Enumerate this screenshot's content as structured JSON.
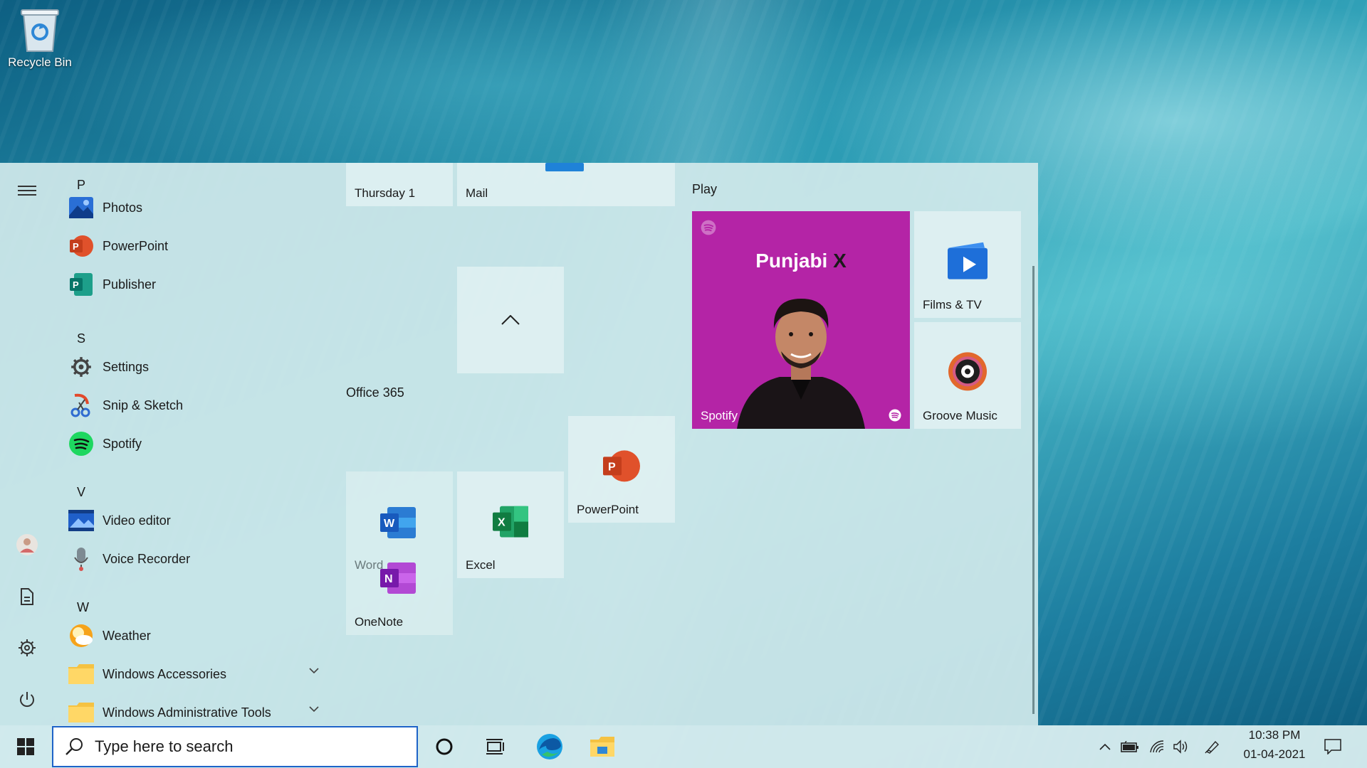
{
  "desktop": {
    "icons": [
      {
        "label": "Recycle Bin",
        "icon": "recycle-bin-icon"
      }
    ]
  },
  "start_menu": {
    "rail": {
      "menu_icon": "hamburger-icon",
      "user_icon": "user-avatar-icon",
      "documents_icon": "documents-icon",
      "settings_icon": "gear-icon",
      "power_icon": "power-icon"
    },
    "app_list": [
      {
        "type": "letter",
        "label": "P"
      },
      {
        "type": "app",
        "label": "Photos",
        "icon": "photos-icon"
      },
      {
        "type": "app",
        "label": "PowerPoint",
        "icon": "powerpoint-icon"
      },
      {
        "type": "app",
        "label": "Publisher",
        "icon": "publisher-icon"
      },
      {
        "type": "letter",
        "label": "S"
      },
      {
        "type": "app",
        "label": "Settings",
        "icon": "gear-icon"
      },
      {
        "type": "app",
        "label": "Snip & Sketch",
        "icon": "snip-sketch-icon"
      },
      {
        "type": "app",
        "label": "Spotify",
        "icon": "spotify-icon"
      },
      {
        "type": "letter",
        "label": "V"
      },
      {
        "type": "app",
        "label": "Video editor",
        "icon": "video-editor-icon"
      },
      {
        "type": "app",
        "label": "Voice Recorder",
        "icon": "microphone-icon"
      },
      {
        "type": "letter",
        "label": "W"
      },
      {
        "type": "app",
        "label": "Weather",
        "icon": "weather-icon"
      },
      {
        "type": "folder",
        "label": "Windows Accessories",
        "icon": "folder-icon"
      },
      {
        "type": "folder",
        "label": "Windows Administrative Tools",
        "icon": "folder-icon"
      }
    ],
    "tiles": {
      "calendar_label": "Thursday 1",
      "mail_label": "Mail",
      "office_group_title": "Office 365",
      "word_label": "Word",
      "onenote_label": "OneNote",
      "excel_label": "Excel",
      "powerpoint_label": "PowerPoint",
      "play_group_title": "Play",
      "spotify_label": "Spotify",
      "spotify_playlist": "Punjabi",
      "spotify_playlist_mark": "X",
      "films_label": "Films & TV",
      "groove_label": "Groove Music"
    }
  },
  "taskbar": {
    "search_placeholder": "Type here to search",
    "time": "10:38 PM",
    "date": "01-04-2021",
    "icons": [
      "windows-start-icon",
      "search-icon",
      "cortana-icon",
      "task-view-icon",
      "edge-icon",
      "file-explorer-icon",
      "chevron-up-icon",
      "battery-icon",
      "wifi-icon",
      "volume-icon",
      "pen-icon",
      "notifications-icon"
    ]
  },
  "colors": {
    "spotify_tile": "#b424a6",
    "accent": "#1e63c8",
    "menu_background": "#cee8ea"
  }
}
